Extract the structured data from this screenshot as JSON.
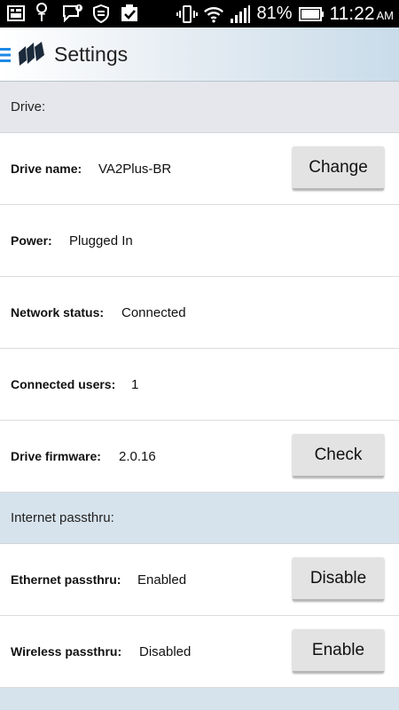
{
  "status_bar": {
    "battery_percent": "81%",
    "time": "11:22",
    "ampm": "AM",
    "icons": [
      "gallery-icon",
      "tmobile-icon",
      "message-alert-icon",
      "shield-icon",
      "task-check-icon",
      "vibrate-icon",
      "wifi-icon",
      "signal-icon",
      "battery-icon"
    ]
  },
  "app_bar": {
    "title": "Settings",
    "icons": [
      "menu-icon",
      "app-logo-icon"
    ]
  },
  "drive_section": {
    "header": "Drive:",
    "rows": [
      {
        "label": "Drive name:",
        "value": "VA2Plus-BR",
        "button": "Change"
      },
      {
        "label": "Power:",
        "value": "Plugged In"
      },
      {
        "label": "Network status:",
        "value": "Connected"
      },
      {
        "label": "Connected users:",
        "value": "1"
      },
      {
        "label": "Drive firmware:",
        "value": "2.0.16",
        "button": "Check"
      }
    ]
  },
  "passthru_section": {
    "header": "Internet passthru:",
    "rows": [
      {
        "label": "Ethernet passthru:",
        "value": "Enabled",
        "button": "Disable"
      },
      {
        "label": "Wireless passthru:",
        "value": "Disabled",
        "button": "Enable"
      }
    ]
  },
  "colors": {
    "section_header_gray": "#e5e7ec",
    "section_header_blue": "#d7e3ec",
    "button_bg": "#e3e3e3",
    "menu_blue": "#1e88e5"
  }
}
